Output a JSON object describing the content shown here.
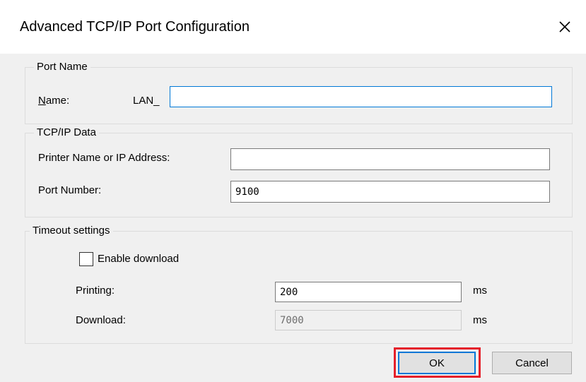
{
  "dialog": {
    "title": "Advanced TCP/IP Port Configuration"
  },
  "port_name": {
    "group_label": "Port Name",
    "name_label_underlined": "N",
    "name_label_rest": "ame:",
    "name_prefix": "LAN_",
    "name_value": ""
  },
  "tcpip": {
    "group_label": "TCP/IP Data",
    "address_label": "Printer Name or IP Address:",
    "address_value": "",
    "port_label": "Port Number:",
    "port_value": "9100"
  },
  "timeout": {
    "group_label": "Timeout settings",
    "enable_download_label": "Enable download",
    "enable_download_checked": false,
    "printing_label": "Printing:",
    "printing_value": "200",
    "printing_unit": "ms",
    "download_label": "Download:",
    "download_value": "7000",
    "download_unit": "ms"
  },
  "buttons": {
    "ok_label": "OK",
    "cancel_label": "Cancel"
  },
  "colors": {
    "highlight": "#e5202a",
    "focus": "#0078d7"
  },
  "icons": {
    "close": "close-icon"
  }
}
